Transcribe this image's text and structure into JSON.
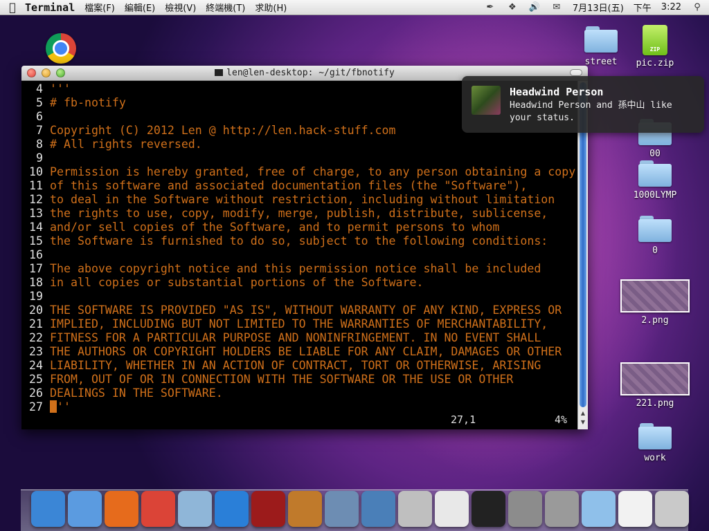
{
  "menubar": {
    "app_name": "Terminal",
    "menus": [
      "檔案(F)",
      "編輯(E)",
      "檢視(V)",
      "終端機(T)",
      "求助(H)"
    ],
    "date": "7月13日(五)",
    "ampm": "下午",
    "time": "3:22"
  },
  "terminal": {
    "title": "len@len-desktop: ~/git/fbnotify",
    "lines": [
      {
        "n": "4",
        "t": "'''"
      },
      {
        "n": "5",
        "t": "# fb-notify"
      },
      {
        "n": "6",
        "t": ""
      },
      {
        "n": "7",
        "t": "Copyright (C) 2012 Len @ http://len.hack-stuff.com"
      },
      {
        "n": "8",
        "t": "# All rights reversed."
      },
      {
        "n": "9",
        "t": ""
      },
      {
        "n": "10",
        "t": "Permission is hereby granted, free of charge, to any person obtaining a copy"
      },
      {
        "n": "11",
        "t": "of this software and associated documentation files (the \"Software\"),"
      },
      {
        "n": "12",
        "t": "to deal in the Software without restriction, including without limitation"
      },
      {
        "n": "13",
        "t": "the rights to use, copy, modify, merge, publish, distribute, sublicense,"
      },
      {
        "n": "14",
        "t": "and/or sell copies of the Software, and to permit persons to whom"
      },
      {
        "n": "15",
        "t": "the Software is furnished to do so, subject to the following conditions:"
      },
      {
        "n": "16",
        "t": ""
      },
      {
        "n": "17",
        "t": "The above copyright notice and this permission notice shall be included"
      },
      {
        "n": "18",
        "t": "in all copies or substantial portions of the Software."
      },
      {
        "n": "19",
        "t": ""
      },
      {
        "n": "20",
        "t": "THE SOFTWARE IS PROVIDED \"AS IS\", WITHOUT WARRANTY OF ANY KIND, EXPRESS OR"
      },
      {
        "n": "21",
        "t": "IMPLIED, INCLUDING BUT NOT LIMITED TO THE WARRANTIES OF MERCHANTABILITY,"
      },
      {
        "n": "22",
        "t": "FITNESS FOR A PARTICULAR PURPOSE AND NONINFRINGEMENT. IN NO EVENT SHALL"
      },
      {
        "n": "23",
        "t": "THE AUTHORS OR COPYRIGHT HOLDERS BE LIABLE FOR ANY CLAIM, DAMAGES OR OTHER"
      },
      {
        "n": "24",
        "t": "LIABILITY, WHETHER IN AN ACTION OF CONTRACT, TORT OR OTHERWISE, ARISING"
      },
      {
        "n": "25",
        "t": "FROM, OUT OF OR IN CONNECTION WITH THE SOFTWARE OR THE USE OR OTHER"
      },
      {
        "n": "26",
        "t": "DEALINGS IN THE SOFTWARE."
      },
      {
        "n": "27",
        "t": "''",
        "cursor": true
      }
    ],
    "cursor_position": "27,1",
    "scroll_percent": "4%"
  },
  "notification": {
    "title": "Headwind Person",
    "message": "Headwind Person and 孫中山 like your status."
  },
  "desktop_icons": {
    "street": "street",
    "pic_zip": "pic.zip",
    "f00": "00",
    "f1000lymp": "1000LYMP",
    "f0": "0",
    "png2": "2.png",
    "png221": "221.png",
    "work": "work",
    "zip_badge": "ZIP"
  },
  "dock": [
    {
      "name": "anchor-icon",
      "color": "#3b86d6"
    },
    {
      "name": "finder-icon",
      "color": "#5b9be0"
    },
    {
      "name": "firefox-icon",
      "color": "#e66b1c"
    },
    {
      "name": "chrome-icon",
      "color": "#db4437"
    },
    {
      "name": "mail-icon",
      "color": "#8fb6d8"
    },
    {
      "name": "itunes-icon",
      "color": "#2a7fd8"
    },
    {
      "name": "photobooth-icon",
      "color": "#9c1b1b"
    },
    {
      "name": "iphoto-icon",
      "color": "#c07a2b"
    },
    {
      "name": "preview-icon",
      "color": "#6d8db3"
    },
    {
      "name": "scanner-icon",
      "color": "#4a7fb8"
    },
    {
      "name": "printer-icon",
      "color": "#bfbfbf"
    },
    {
      "name": "textedit-icon",
      "color": "#e8e8e8"
    },
    {
      "name": "terminal-icon",
      "color": "#222222"
    },
    {
      "name": "calculator-icon",
      "color": "#8c8c8c"
    },
    {
      "name": "system-prefs-icon",
      "color": "#9a9a9a"
    },
    {
      "name": "folder-icon",
      "color": "#8fc0ea"
    },
    {
      "name": "r-app-icon",
      "color": "#f2f2f2"
    },
    {
      "name": "trash-icon",
      "color": "#c9c9c9"
    }
  ]
}
